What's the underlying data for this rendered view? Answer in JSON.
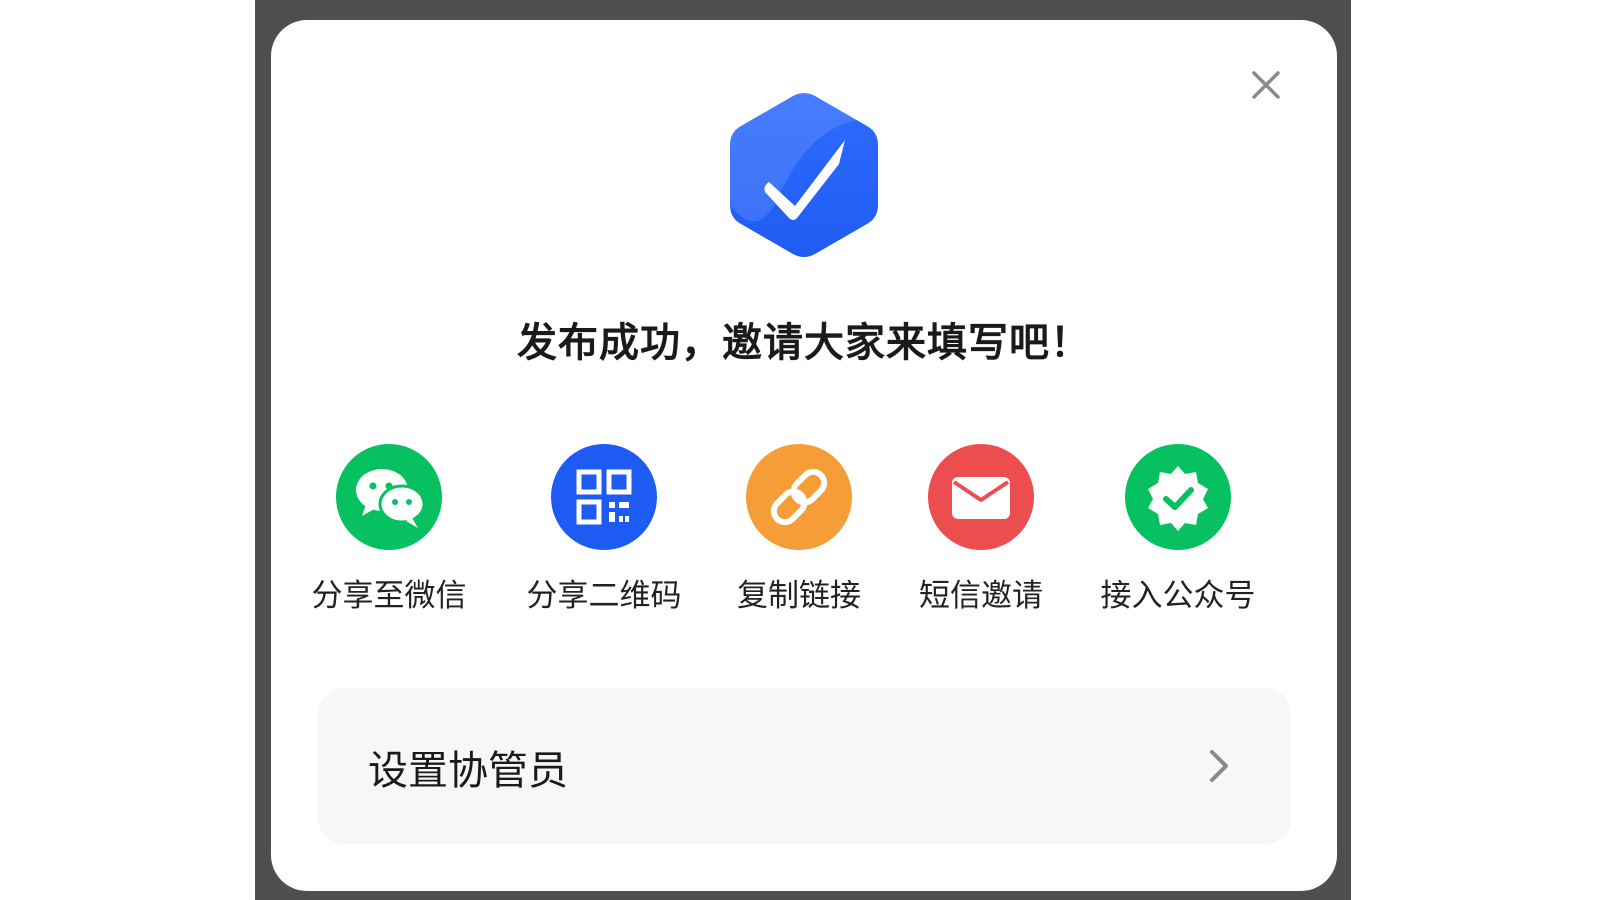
{
  "dialog": {
    "title": "发布成功，邀请大家来填写吧！",
    "close_icon": "close-icon",
    "hero_icon": "hexagon-check-icon"
  },
  "share_options": [
    {
      "label": "分享至微信",
      "icon": "wechat-icon",
      "color": "#07c160"
    },
    {
      "label": "分享二维码",
      "icon": "qr-code-icon",
      "color": "#1d5bf2"
    },
    {
      "label": "复制链接",
      "icon": "link-icon",
      "color": "#f59d36"
    },
    {
      "label": "短信邀请",
      "icon": "envelope-icon",
      "color": "#ec4e50"
    },
    {
      "label": "接入公众号",
      "icon": "verified-badge-icon",
      "color": "#07c160"
    }
  ],
  "coadmin_row": {
    "label": "设置协管员",
    "icon": "chevron-right-icon"
  },
  "colors": {
    "backdrop": "#4f4f4f",
    "card": "#ffffff",
    "row_bg": "#f6f7f9",
    "accent_blue": "#2f6bff"
  }
}
